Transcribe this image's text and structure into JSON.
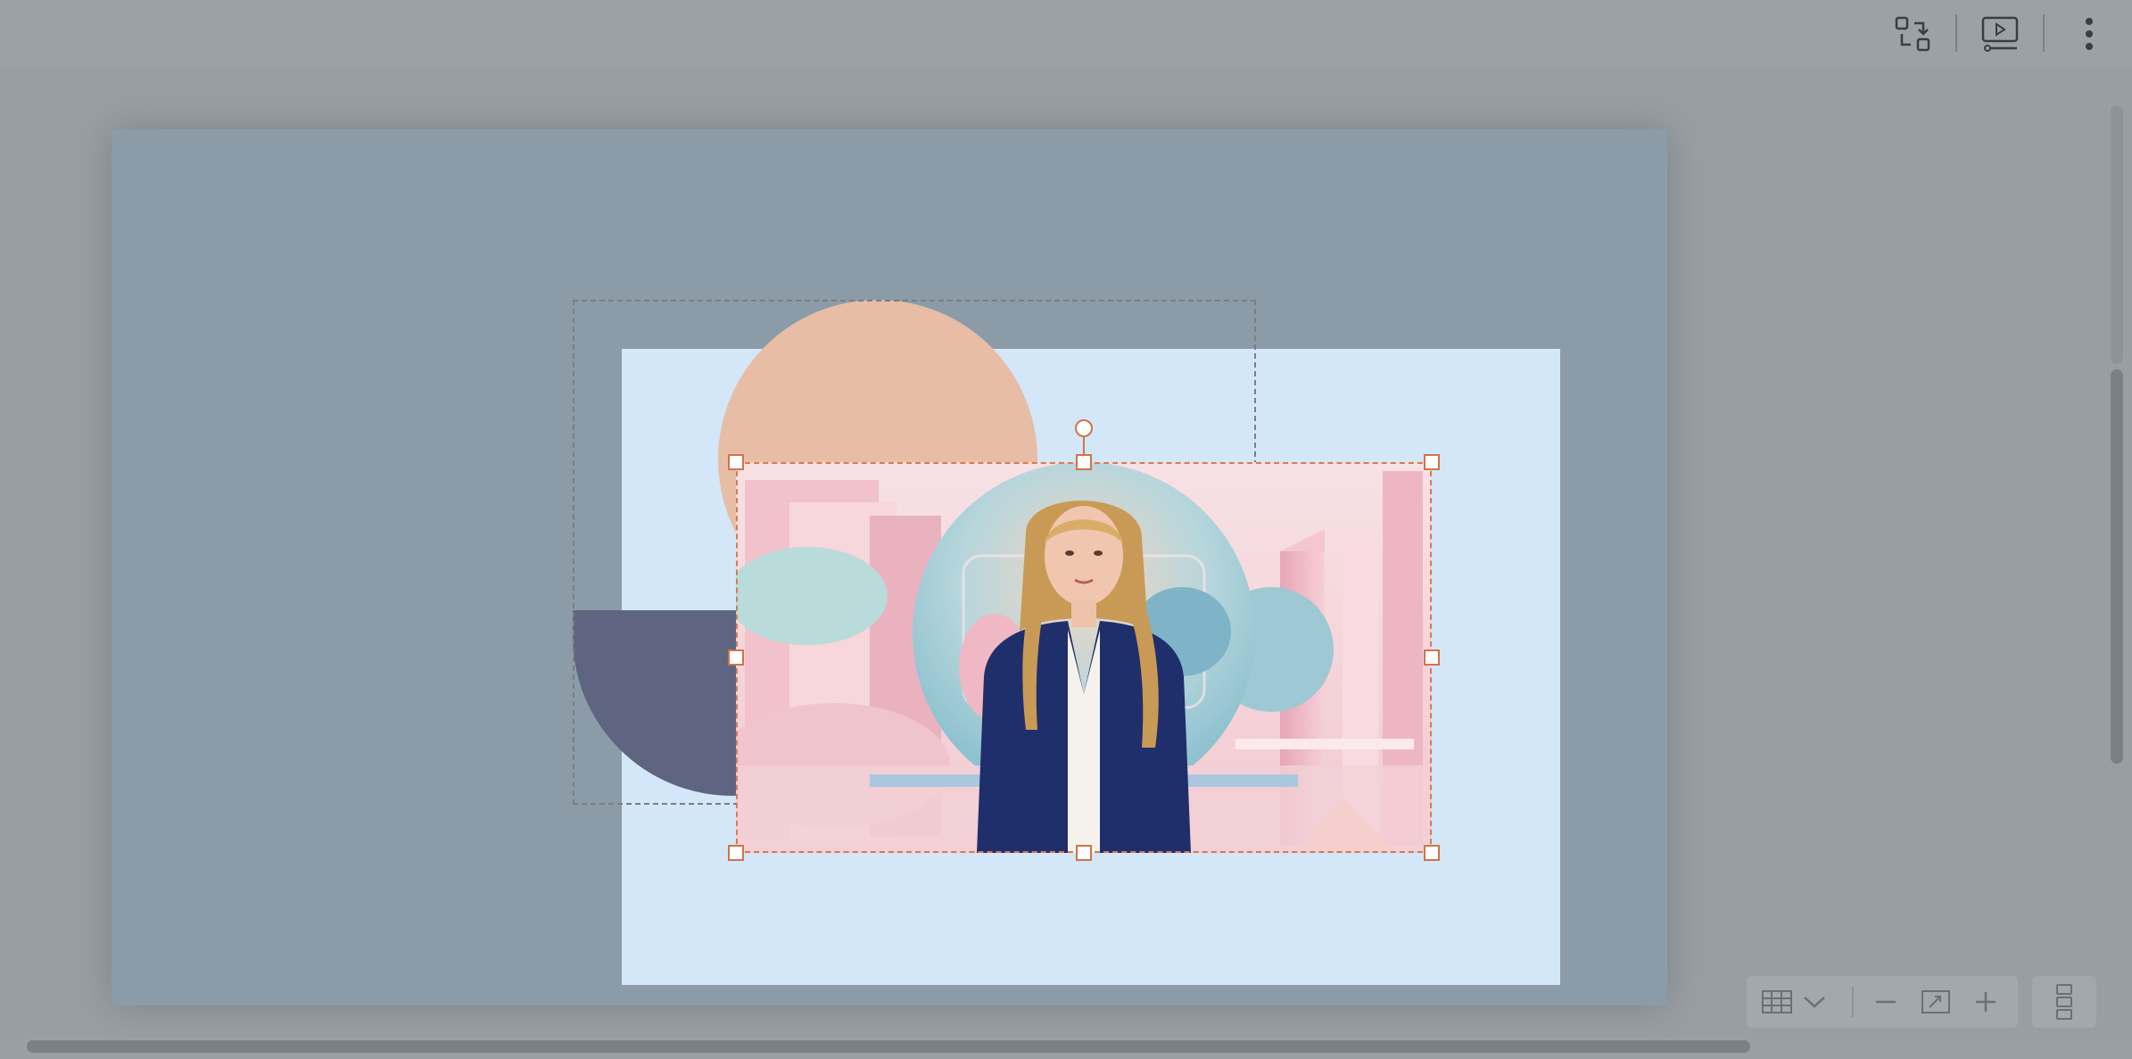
{
  "toolbar": {
    "icons": [
      "swap-layout-icon",
      "presentation-preview-icon",
      "more-vertical-icon"
    ]
  },
  "canvas": {
    "slide_background": "#8c9ba8",
    "frame_background": "#d3e7f8",
    "peach_color": "#e7bda6",
    "navy_color": "#5f6580",
    "selection_color": "#d07448"
  },
  "video": {
    "subject": "presenter-avatar",
    "scene": "pastel-city-background"
  },
  "zoombar": {
    "icons": [
      "grid-icon",
      "chevron-down-icon",
      "zoom-out-icon",
      "fit-to-screen-icon",
      "zoom-in-icon"
    ]
  },
  "side_panel": {
    "icon": "panel-layout-icon"
  }
}
